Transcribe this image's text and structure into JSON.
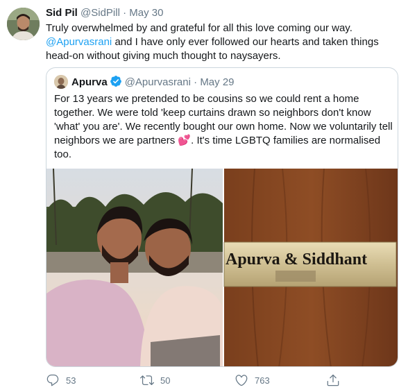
{
  "tweet": {
    "author_name": "Sid Pil",
    "handle": "@SidPill",
    "separator": "·",
    "date": "May 30",
    "text_line1": "Truly overwhelmed by and grateful for all this love coming our way.",
    "mention": "@Apurvasrani",
    "text_after_mention": " and I have only ever followed our hearts and taken things head-on without giving much thought to naysayers."
  },
  "quoted": {
    "author_name": "Apurva",
    "handle": "@Apurvasrani",
    "separator": "·",
    "date": "May 29",
    "text": "For 13 years we pretended to be cousins so we could rent a home together. We were told 'keep curtains drawn so neighbors don't know 'what' you are'. We recently bought our own home. Now we voluntarily tell neighbors we are partners 💕. It's time LGBTQ families are normalised too.",
    "nameplate_text": "Apurva & Siddhant"
  },
  "actions": {
    "replies": "53",
    "retweets": "50",
    "likes": "763"
  },
  "colors": {
    "link": "#1da1f2",
    "muted": "#657786",
    "border": "#ccd6dd",
    "verified": "#1da1f2"
  },
  "icons": [
    "reply-icon",
    "retweet-icon",
    "like-icon",
    "share-icon",
    "verified-badge-icon"
  ]
}
